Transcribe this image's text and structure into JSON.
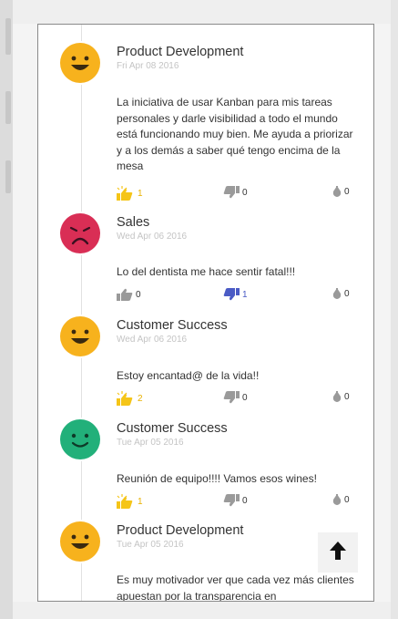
{
  "posts": [
    {
      "mood": "happy",
      "mood_color": "#f7b21d",
      "team": "Product Development",
      "date": "Fri Apr 08 2016",
      "text": "La iniciativa de usar Kanban para mis tareas personales y darle visibilidad a todo el mundo está funcionando muy bien. Me ayuda a priorizar y a los demás a saber qué tengo encima de la mesa",
      "likes": "1",
      "dislikes": "0",
      "comments": "0",
      "liked": true,
      "disliked": false
    },
    {
      "mood": "sad",
      "mood_color": "#d92e55",
      "team": "Sales",
      "date": "Wed Apr 06 2016",
      "text": "Lo del dentista me hace sentir fatal!!!",
      "likes": "0",
      "dislikes": "1",
      "comments": "0",
      "liked": false,
      "disliked": true
    },
    {
      "mood": "happy",
      "mood_color": "#f7b21d",
      "team": "Customer Success",
      "date": "Wed Apr 06 2016",
      "text": "Estoy encantad@ de la vida!!",
      "likes": "2",
      "dislikes": "0",
      "comments": "0",
      "liked": true,
      "disliked": false
    },
    {
      "mood": "content",
      "mood_color": "#22b07a",
      "team": "Customer Success",
      "date": "Tue Apr 05 2016",
      "text": "Reunión de equipo!!!! Vamos esos wines!",
      "likes": "1",
      "dislikes": "0",
      "comments": "0",
      "liked": true,
      "disliked": false
    },
    {
      "mood": "happy",
      "mood_color": "#f7b21d",
      "team": "Product Development",
      "date": "Tue Apr 05 2016",
      "text": "Es muy motivador ver que cada vez más clientes apuestan por la transparencia en"
    }
  ],
  "colors": {
    "like_active": "#f5c518",
    "dislike_active": "#4a5bc5",
    "inactive_icon": "#9a9a9a"
  },
  "icons": {
    "like": "thumbs-up-icon",
    "dislike": "thumbs-down-icon",
    "comment": "comment-icon",
    "scroll_top": "arrow-up-icon"
  }
}
